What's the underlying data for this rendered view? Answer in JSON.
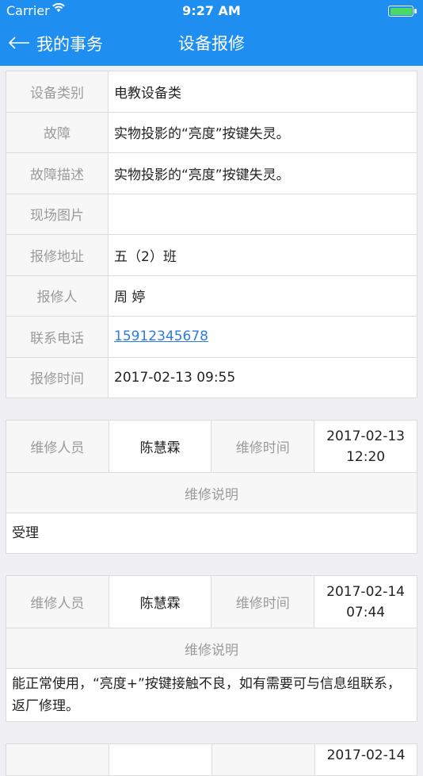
{
  "status": {
    "carrier": "Carrier",
    "time": "9:27 AM"
  },
  "nav": {
    "back_label": "我的事务",
    "title": "设备报修"
  },
  "info": {
    "rows": [
      {
        "label": "设备类别",
        "value": "电教设备类"
      },
      {
        "label": "故障",
        "value": "实物投影的“亮度”按键失灵。"
      },
      {
        "label": "故障描述",
        "value": "实物投影的“亮度”按键失灵。"
      },
      {
        "label": "现场图片",
        "value": ""
      },
      {
        "label": "报修地址",
        "value": "五（2）班"
      },
      {
        "label": "报修人",
        "value": "周 婷"
      },
      {
        "label": "联系电话",
        "value": "15912345678"
      },
      {
        "label": "报修时间",
        "value": "2017-02-13 09:55"
      }
    ]
  },
  "labels": {
    "repairer": "维修人员",
    "repair_time": "维修时间",
    "repair_note": "维修说明"
  },
  "records": [
    {
      "repairer": "陈慧霖",
      "date": "2017-02-13",
      "clock": "12:20",
      "note": "受理"
    },
    {
      "repairer": "陈慧霖",
      "date": "2017-02-14",
      "clock": "07:44",
      "note": "能正常使用，“亮度+”按键接触不良，如有需要可与信息组联系，返厂修理。"
    }
  ],
  "partial_record": {
    "date": "2017-02-14"
  },
  "colors": {
    "nav_bg": "#1f8ef1",
    "battery": "#4cd964",
    "link": "#2a7de1"
  }
}
